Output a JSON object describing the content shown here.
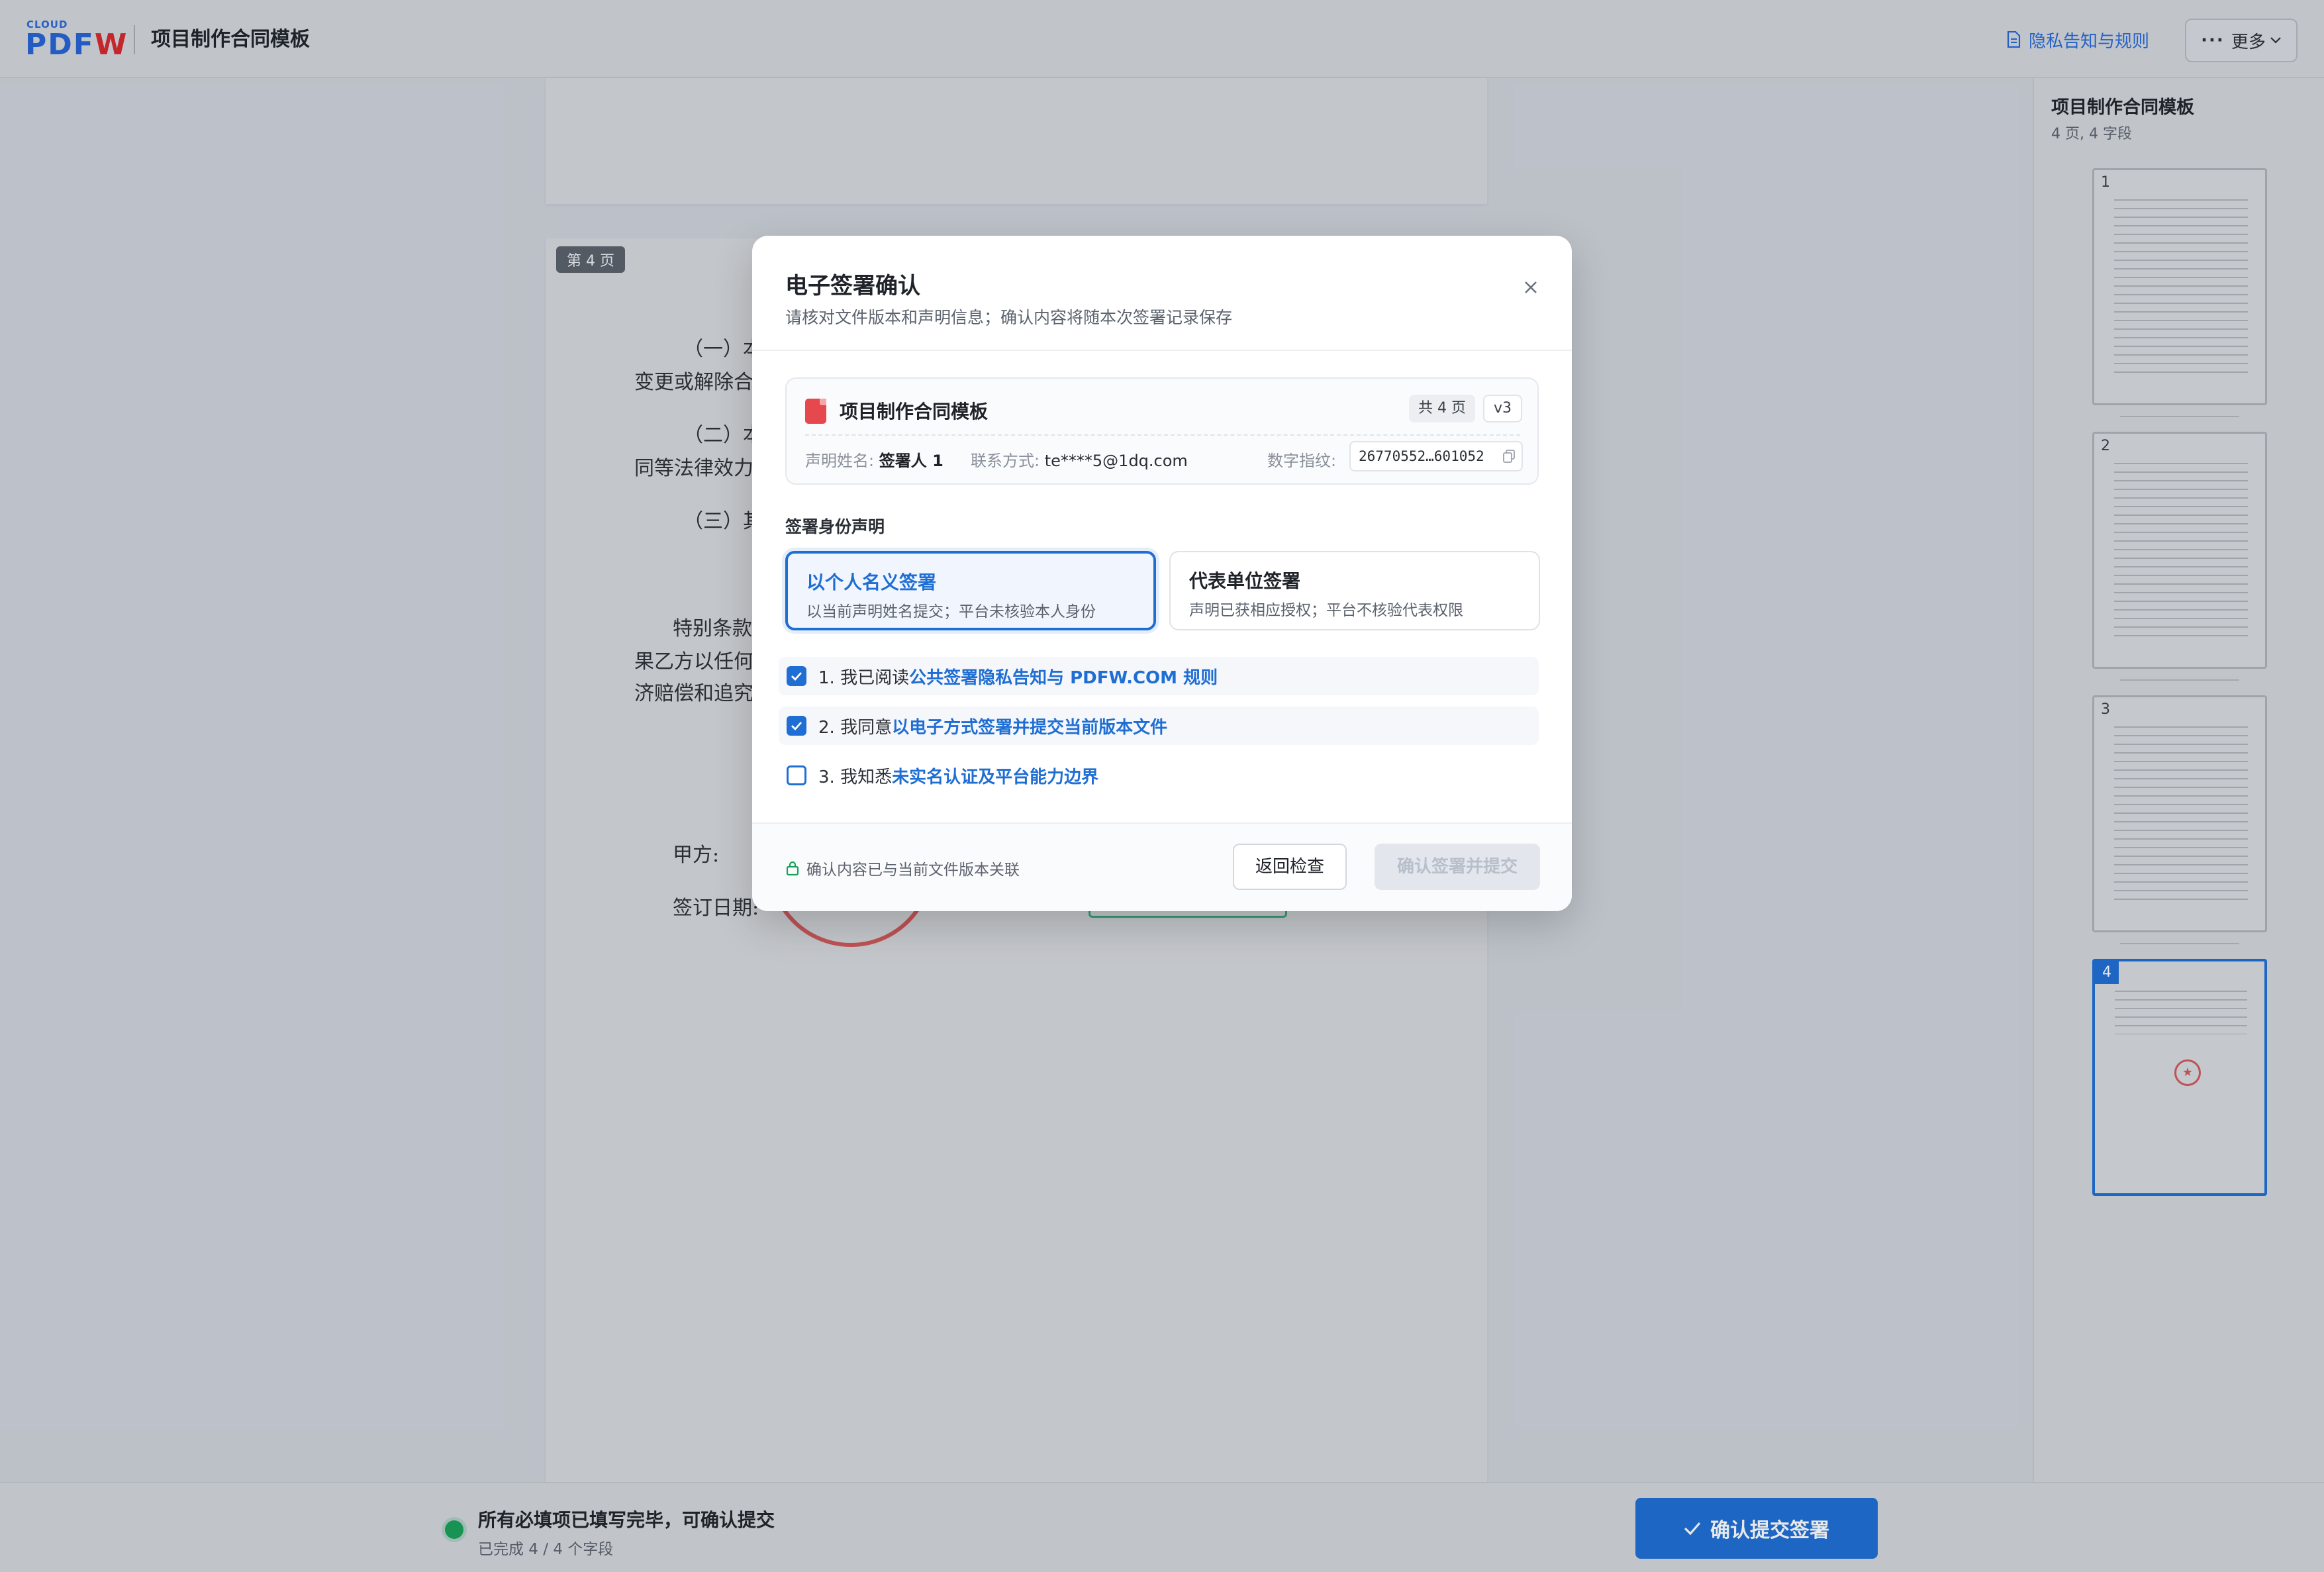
{
  "header": {
    "logo_small": "CLOUD",
    "logo_main_blue": "PDF",
    "logo_main_red": "W",
    "title": "项目制作合同模板",
    "privacy_link": "隐私告知与规则",
    "more_label": "更多"
  },
  "document": {
    "page_badge": "第 4 页",
    "lines": [
      "（一）本",
      "变更或解除合",
      "（二）本",
      "同等法律效力",
      "（三）其",
      "特别条款",
      "果乙方以任何",
      "济赔偿和追究",
      "甲方:",
      "签订日期:"
    ]
  },
  "thumbnails": {
    "title": "项目制作合同模板",
    "subtitle": "4 页, 4 字段",
    "pages": [
      "1",
      "2",
      "3",
      "4"
    ],
    "active_page": "4"
  },
  "bottom": {
    "status_main": "所有必填项已填写完毕，可确认提交",
    "status_sub": "已完成 4 / 4 个字段",
    "confirm_button": "确认提交签署"
  },
  "modal": {
    "title": "电子签署确认",
    "description": "请核对文件版本和声明信息；确认内容将随本次签署记录保存",
    "file": {
      "name": "项目制作合同模板",
      "pages_tag": "共 4 页",
      "version_tag": "v3",
      "signer_label": "声明姓名:",
      "signer_value": "签署人 1",
      "contact_label": "联系方式:",
      "contact_value": "te****5@1dq.com",
      "fingerprint_label": "数字指纹:",
      "fingerprint_value": "26770552…601052"
    },
    "identity_section": "签署身份声明",
    "identity_options": [
      {
        "title": "以个人名义签署",
        "desc": "以当前声明姓名提交；平台未核验本人身份",
        "selected": true
      },
      {
        "title": "代表单位签署",
        "desc": "声明已获相应授权；平台不核验代表权限",
        "selected": false
      }
    ],
    "checks": [
      {
        "prefix": "1. 我已阅读",
        "link": "公共签署隐私告知与 PDFW.COM 规则",
        "checked": true
      },
      {
        "prefix": "2. 我同意",
        "link": "以电子方式签署并提交当前版本文件",
        "checked": true
      },
      {
        "prefix": "3. 我知悉",
        "link": "未实名认证及平台能力边界",
        "checked": false
      }
    ],
    "footer_note": "确认内容已与当前文件版本关联",
    "back_button": "返回检查",
    "submit_button": "确认签署并提交"
  },
  "colors": {
    "primary": "#1f6ed4",
    "logo_red": "#d8262b",
    "success": "#18a058",
    "stamp_red": "#d25759"
  }
}
